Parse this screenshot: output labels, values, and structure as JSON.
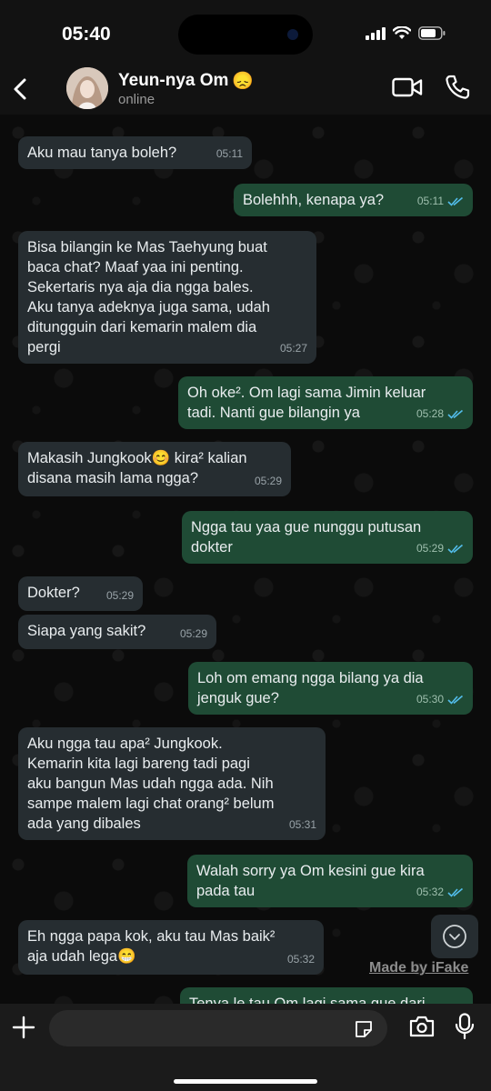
{
  "status_bar": {
    "time": "05:40"
  },
  "header": {
    "contact_name": "Yeun-nya Om",
    "contact_emoji": "😞",
    "status": "online"
  },
  "messages": [
    {
      "dir": "in",
      "text": "Aku mau tanya boleh?",
      "time": "05:11"
    },
    {
      "dir": "out",
      "text": "Bolehhh, kenapa ya?",
      "time": "05:11",
      "read": true
    },
    {
      "dir": "in",
      "text": "Bisa bilangin ke Mas Taehyung buat\nbaca chat? Maaf yaa ini penting.\nSekertaris nya aja dia ngga bales.\nAku tanya adeknya juga sama, udah\nditungguin dari kemarin malem dia\npergi",
      "time": "05:27"
    },
    {
      "dir": "out",
      "text": "Oh oke². Om lagi sama Jimin keluar\ntadi. Nanti gue bilangin ya",
      "time": "05:28",
      "read": true
    },
    {
      "dir": "in",
      "text": "Makasih Jungkook😊 kira² kalian\ndisana masih lama ngga?",
      "time": "05:29"
    },
    {
      "dir": "out",
      "text": "Ngga tau yaa gue nunggu putusan\ndokter",
      "time": "05:29",
      "read": true
    },
    {
      "dir": "in",
      "text": "Dokter?",
      "time": "05:29"
    },
    {
      "dir": "in",
      "text": "Siapa yang sakit?",
      "time": "05:29"
    },
    {
      "dir": "out",
      "text": "Loh om emang ngga bilang ya dia\njenguk gue?",
      "time": "05:30",
      "read": true
    },
    {
      "dir": "in",
      "text": "Aku ngga tau apa² Jungkook.\nKemarin kita lagi bareng tadi pagi\naku bangun Mas udah ngga ada. Nih\nsampe malem lagi chat orang² belum\nada yang dibales",
      "time": "05:31"
    },
    {
      "dir": "out",
      "text": "Walah sorry ya Om kesini gue kira\npada tau",
      "time": "05:32",
      "read": true
    },
    {
      "dir": "in",
      "text": "Eh ngga papa kok, aku tau Mas baik²\naja udah lega😁",
      "time": "05:32"
    },
    {
      "dir": "out",
      "text": "Tenya le tau Om lagi sama gue dari",
      "time": "",
      "read": false
    }
  ],
  "watermark": "Made by iFake",
  "icons": {
    "back": "chevron-left-icon",
    "video_call": "video-camera-icon",
    "voice_call": "phone-icon",
    "scroll_down": "chevron-down-circle-icon",
    "attach": "plus-icon",
    "sticker": "sticker-icon",
    "camera": "camera-icon",
    "mic": "microphone-icon"
  },
  "colors": {
    "incoming_bubble": "#262d31",
    "outgoing_bubble": "#1f4b35",
    "read_ticks": "#53bdeb"
  }
}
